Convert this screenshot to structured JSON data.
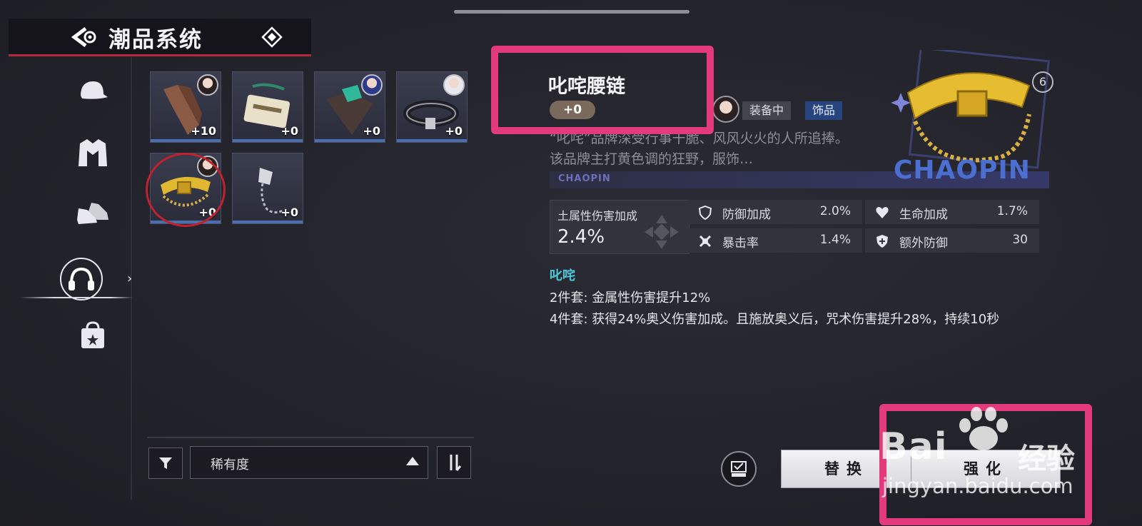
{
  "header": {
    "title": "潮品系统"
  },
  "categories": [
    {
      "icon": "cap-icon"
    },
    {
      "icon": "jacket-icon"
    },
    {
      "icon": "shoes-icon"
    },
    {
      "icon": "headphones-icon",
      "active": true
    },
    {
      "icon": "bag-icon"
    }
  ],
  "items": [
    {
      "name": "tie",
      "level": "+10",
      "owner": "dark-hair"
    },
    {
      "name": "badge",
      "level": "+0",
      "owner": ""
    },
    {
      "name": "scarf",
      "level": "+0",
      "owner": "blue-hair"
    },
    {
      "name": "belt",
      "level": "+0",
      "owner": "white-hair"
    },
    {
      "name": "gold-chain-belt",
      "level": "+0",
      "owner": "dark-hair",
      "selected": true
    },
    {
      "name": "chain-pendant",
      "level": "+0",
      "owner": ""
    }
  ],
  "filter": {
    "sort_label": "稀有度"
  },
  "detail": {
    "name": "叱咤腰链",
    "level": "+0",
    "status": "装备中",
    "type": "饰品",
    "description": "“叱咤”品牌深受行事干脆、风风火火的人所追捧。该品牌主打黄色调的狂野，服饰…",
    "brand_strip": "CHAOPIN",
    "brand_watermark": "CHAOPIN",
    "set_number": "6",
    "main_stat": {
      "label": "土属性伤害加成",
      "value": "2.4%"
    },
    "sub_stats": [
      {
        "icon": "shield-icon",
        "label": "防御加成",
        "value": "2.0%"
      },
      {
        "icon": "heart-icon",
        "label": "生命加成",
        "value": "1.7%"
      },
      {
        "icon": "crit-icon",
        "label": "暴击率",
        "value": "1.4%"
      },
      {
        "icon": "shield-plus-icon",
        "label": "额外防御",
        "value": "30"
      }
    ],
    "set_name": "叱咤",
    "set_2": "2件套: 金属性伤害提升12%",
    "set_4": "4件套: 获得24%奥义伤害加成。且施放奥义后，咒术伤害提升28%，持续10秒"
  },
  "actions": {
    "replace": "替换",
    "enhance": "强化"
  },
  "watermark": {
    "brand": "Bai",
    "brand_tail": "经验",
    "url": "jingyan.baidu.com"
  },
  "colors": {
    "highlight": "#e23a7a",
    "accent_red": "#c0212f",
    "set_name": "#4fc6d8",
    "rarity_bar": "#4a6fb0"
  }
}
